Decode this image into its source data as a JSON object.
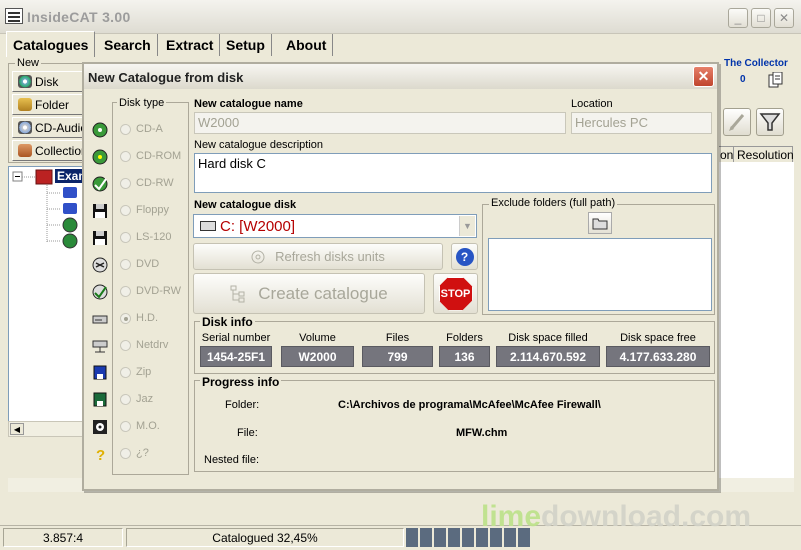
{
  "window": {
    "title": "InsideCAT 3.00",
    "minimize_glyph": "_",
    "maximize_glyph": "□",
    "close_glyph": "✕"
  },
  "menu_tabs": [
    "Catalogues",
    "Search",
    "Extract",
    "Setup",
    "About"
  ],
  "new_panel": {
    "label": "New",
    "buttons": [
      "Disk",
      "Folder",
      "CD-Audio",
      "Collection"
    ]
  },
  "tree": {
    "root_label": "Exam"
  },
  "collector": {
    "label": "The Collector",
    "count": "0"
  },
  "columns": {
    "partial": "on",
    "resolution": "Resolution"
  },
  "dialog": {
    "title": "New Catalogue from disk",
    "close_glyph": "✕",
    "disk_type": {
      "legend": "Disk type",
      "options": [
        "CD-A",
        "CD-ROM",
        "CD-RW",
        "Floppy",
        "LS-120",
        "DVD",
        "DVD-RW",
        "H.D.",
        "Netdrv",
        "Zip",
        "Jaz",
        "M.O.",
        "¿?"
      ],
      "selected": "H.D."
    },
    "name": {
      "label": "New catalogue name",
      "value": "W2000"
    },
    "location": {
      "label": "Location",
      "value": "Hercules PC"
    },
    "description": {
      "label": "New catalogue description",
      "value": "Hard disk C"
    },
    "disk": {
      "label": "New catalogue disk",
      "value": "C: [W2000]"
    },
    "exclude": {
      "legend": "Exclude folders (full path)"
    },
    "buttons": {
      "refresh": "Refresh disks units",
      "create": "Create catalogue",
      "stop": "STOP",
      "help": "?"
    },
    "disk_info": {
      "legend": "Disk info",
      "fields": [
        {
          "label": "Serial number",
          "value": "1454-25F1"
        },
        {
          "label": "Volume",
          "value": "W2000"
        },
        {
          "label": "Files",
          "value": "799"
        },
        {
          "label": "Folders",
          "value": "136"
        },
        {
          "label": "Disk space filled",
          "value": "2.114.670.592"
        },
        {
          "label": "Disk space free",
          "value": "4.177.633.280"
        }
      ]
    },
    "progress_info": {
      "legend": "Progress info",
      "folder_label": "Folder:",
      "folder_value": "C:\\Archivos de programa\\McAfee\\McAfee Firewall\\",
      "file_label": "File:",
      "file_value": "MFW.chm",
      "nested_label": "Nested file:",
      "nested_value": ""
    }
  },
  "statusbar": {
    "left": "3.857:4",
    "middle": "Catalogued 32,45%",
    "progress": 0.3245
  },
  "watermark": {
    "part1": "lime",
    "part2": "download.com"
  }
}
